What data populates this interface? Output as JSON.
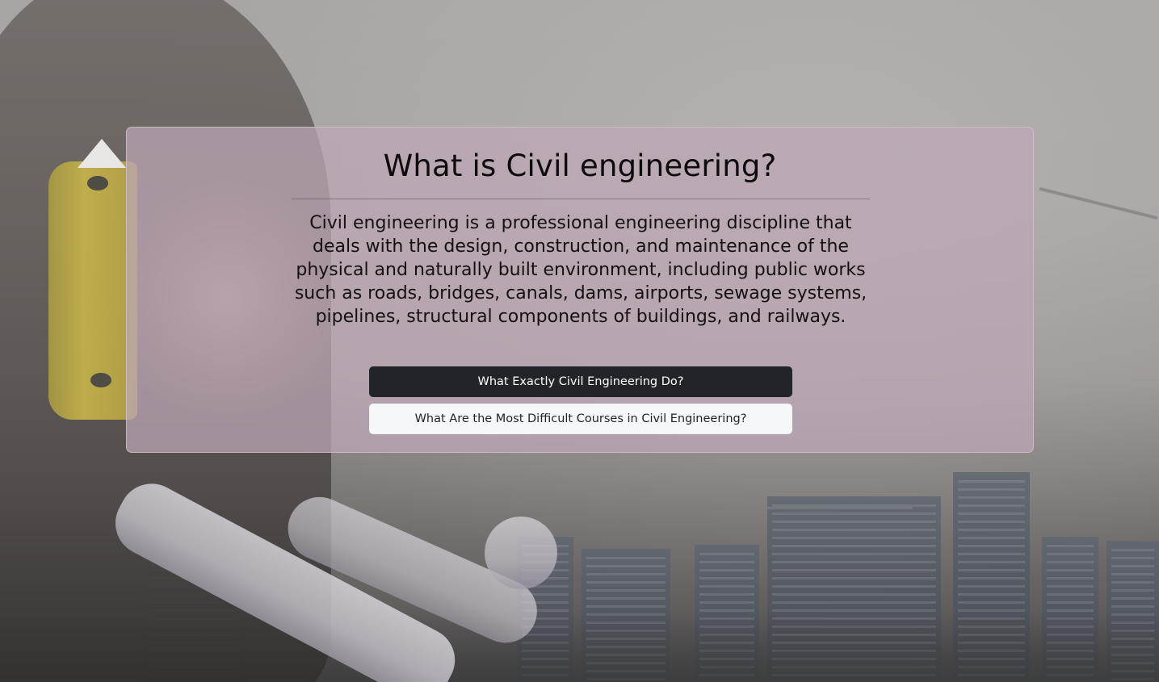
{
  "card": {
    "title": "What is Civil engineering?",
    "description": "Civil engineering is a professional engineering discipline that deals with the design, construction, and maintenance of the physical and naturally built environment, including public works such as roads, bridges, canals, dams, airports, sewage systems, pipelines, structural components of buildings, and railways.",
    "buttons": [
      {
        "label": "What Exactly Civil Engineering Do?",
        "style": "dark"
      },
      {
        "label": "What Are the Most Difficult Courses in Civil Engineering?",
        "style": "light"
      }
    ]
  },
  "colors": {
    "card_background": "#bea8b9",
    "dark_button": "#212529",
    "light_button": "#f6f7f9"
  }
}
